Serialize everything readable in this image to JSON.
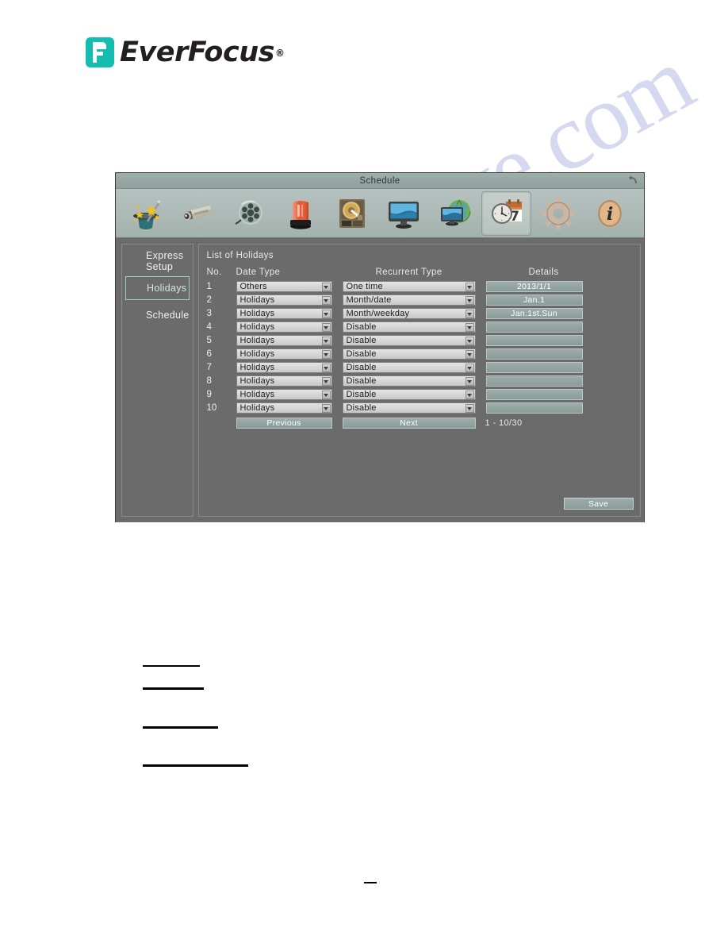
{
  "brand": {
    "name": "EverFocus",
    "registered": "®"
  },
  "watermark": {
    "text": "manualshive.com"
  },
  "window": {
    "title": "Schedule",
    "back_icon": "back-arrow-icon"
  },
  "toolbar": {
    "icons": [
      {
        "name": "express-setup-icon",
        "label": "Express Setup"
      },
      {
        "name": "camera-icon",
        "label": "Camera"
      },
      {
        "name": "record-reel-icon",
        "label": "Record"
      },
      {
        "name": "alarm-beacon-icon",
        "label": "Alarm"
      },
      {
        "name": "hard-disk-icon",
        "label": "Disk"
      },
      {
        "name": "display-monitor-icon",
        "label": "Display"
      },
      {
        "name": "network-globe-icon",
        "label": "Network"
      },
      {
        "name": "schedule-clock-calendar-icon",
        "label": "Schedule",
        "selected": true
      },
      {
        "name": "system-gear-icon",
        "label": "System"
      },
      {
        "name": "information-icon",
        "label": "Information"
      }
    ]
  },
  "sidebar": {
    "items": [
      {
        "label": "Express Setup",
        "active": false
      },
      {
        "label": "Holidays",
        "active": true
      },
      {
        "label": "Schedule",
        "active": false
      }
    ]
  },
  "main": {
    "list_caption": "List of Holidays",
    "columns": {
      "no": "No.",
      "date_type": "Date Type",
      "recurrent_type": "Recurrent Type",
      "details": "Details"
    },
    "rows": [
      {
        "no": "1",
        "date_type": "Others",
        "recurrent_type": "One  time",
        "details": "2013/1/1"
      },
      {
        "no": "2",
        "date_type": "Holidays",
        "recurrent_type": "Month/date",
        "details": "Jan.1"
      },
      {
        "no": "3",
        "date_type": "Holidays",
        "recurrent_type": "Month/weekday",
        "details": "Jan.1st.Sun"
      },
      {
        "no": "4",
        "date_type": "Holidays",
        "recurrent_type": "Disable",
        "details": ""
      },
      {
        "no": "5",
        "date_type": "Holidays",
        "recurrent_type": "Disable",
        "details": ""
      },
      {
        "no": "6",
        "date_type": "Holidays",
        "recurrent_type": "Disable",
        "details": ""
      },
      {
        "no": "7",
        "date_type": "Holidays",
        "recurrent_type": "Disable",
        "details": ""
      },
      {
        "no": "8",
        "date_type": "Holidays",
        "recurrent_type": "Disable",
        "details": ""
      },
      {
        "no": "9",
        "date_type": "Holidays",
        "recurrent_type": "Disable",
        "details": ""
      },
      {
        "no": "10",
        "date_type": "Holidays",
        "recurrent_type": "Disable",
        "details": ""
      }
    ],
    "pager": {
      "previous": "Previous",
      "next": "Next",
      "range": "1 - 10/30"
    },
    "save_label": "Save"
  },
  "colors": {
    "titlebar": "#9fb0ab",
    "toolbar": "#b6c2bf",
    "panel": "#6b6b6b",
    "window_frame": "#4c4c4c",
    "active_outline": "#9fd4b6",
    "button_teal": "#9cadaa",
    "brand_teal": "#14bdb0",
    "watermark": "#7b7fd0"
  }
}
